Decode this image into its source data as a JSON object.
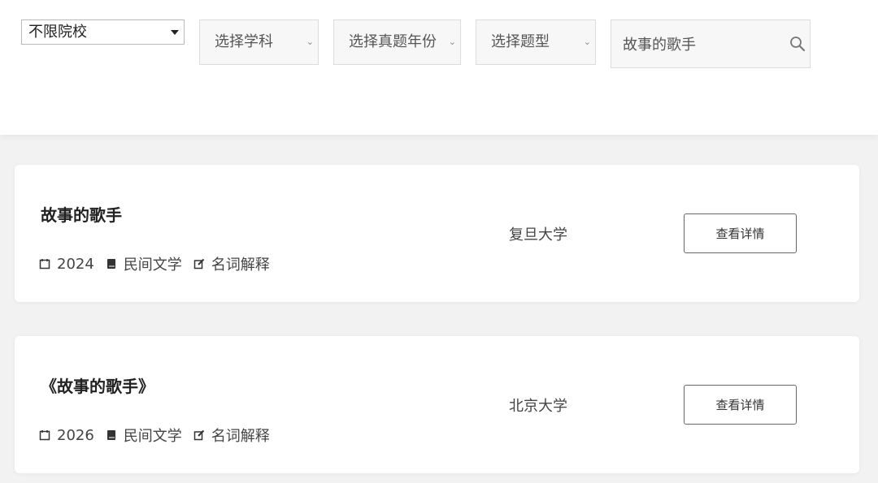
{
  "filters": {
    "school": {
      "selected": "不限院校",
      "icon": "caret-down-icon"
    },
    "subject": {
      "label": "选择学科",
      "icon": "chevron-down-icon"
    },
    "year": {
      "label": "选择真题年份",
      "icon": "chevron-down-icon"
    },
    "type": {
      "label": "选择题型",
      "icon": "chevron-down-icon"
    },
    "search": {
      "value": "故事的歌手",
      "icon": "search-icon"
    }
  },
  "results": [
    {
      "title": "故事的歌手",
      "year": "2024",
      "subject": "民间文学",
      "question_type": "名词解释",
      "school": "复旦大学",
      "button_label": "查看详情"
    },
    {
      "title": "《故事的歌手》",
      "year": "2026",
      "subject": "民间文学",
      "question_type": "名词解释",
      "school": "北京大学",
      "button_label": "查看详情"
    }
  ],
  "colors": {
    "page_bg": "#f2f2f2",
    "card_bg": "#ffffff",
    "input_bg": "#f7f7f7"
  }
}
